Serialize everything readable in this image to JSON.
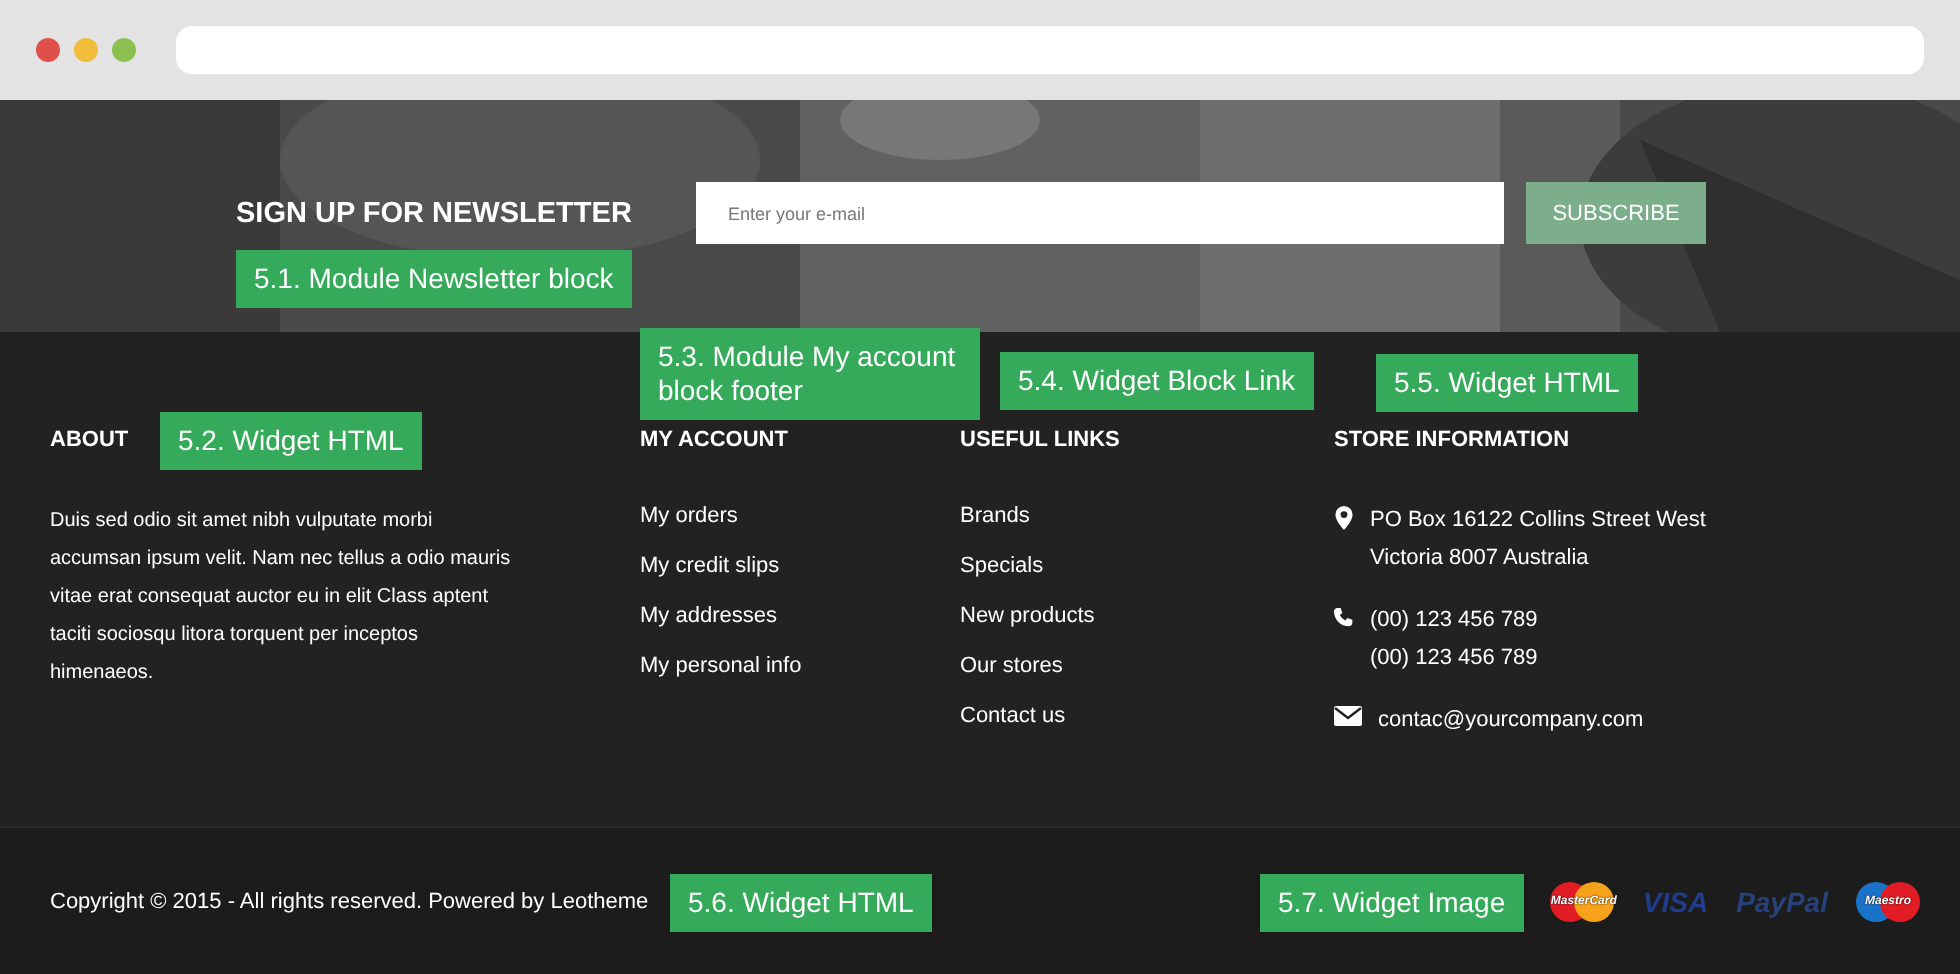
{
  "browser": {
    "dots": [
      {
        "color": "#e0504a"
      },
      {
        "color": "#f0bd3a"
      },
      {
        "color": "#8cc152"
      }
    ]
  },
  "newsletter": {
    "title": "SIGN UP FOR NEWSLETTER",
    "email": {
      "placeholder": "Enter your e-mail"
    },
    "button": "SUBSCRIBE",
    "annotation": "5.1. Module Newsletter block"
  },
  "about": {
    "title": "ABOUT",
    "text": "Duis sed odio sit amet nibh vulputate morbi accumsan ipsum velit. Nam nec tellus a odio mauris vitae erat consequat auctor eu in elit Class aptent taciti sociosqu litora torquent per inceptos himenaeos.",
    "annotation": "5.2. Widget HTML"
  },
  "my_account": {
    "title": "MY ACCOUNT",
    "links": [
      "My orders",
      "My credit slips",
      "My addresses",
      "My personal info"
    ],
    "annotation": "5.3. Module My account block footer"
  },
  "useful_links": {
    "title": "USEFUL LINKS",
    "links": [
      "Brands",
      "Specials",
      "New products",
      "Our stores",
      "Contact us"
    ],
    "annotation": "5.4. Widget Block Link"
  },
  "store_information": {
    "title": "STORE INFORMATION",
    "items": [
      {
        "kind": "address",
        "lines": [
          "PO Box 16122 Collins Street West",
          "Victoria 8007 Australia"
        ]
      },
      {
        "kind": "phone",
        "lines": [
          "(00) 123 456 789",
          "(00) 123 456 789"
        ]
      },
      {
        "kind": "email",
        "lines": [
          "contac@yourcompany.com"
        ]
      }
    ],
    "annotation": "5.5. Widget HTML"
  },
  "copyright": {
    "text": "Copyright © 2015 - All rights reserved. Powered by Leotheme",
    "annotation": "5.6. Widget HTML"
  },
  "payments": {
    "annotation": "5.7. Widget Image",
    "logos": [
      {
        "kind": "mastercard",
        "label": "MasterCard"
      },
      {
        "kind": "visa",
        "label": "VISA"
      },
      {
        "kind": "paypal",
        "label": "PayPal"
      },
      {
        "kind": "maestro",
        "label": "Maestro"
      }
    ]
  }
}
